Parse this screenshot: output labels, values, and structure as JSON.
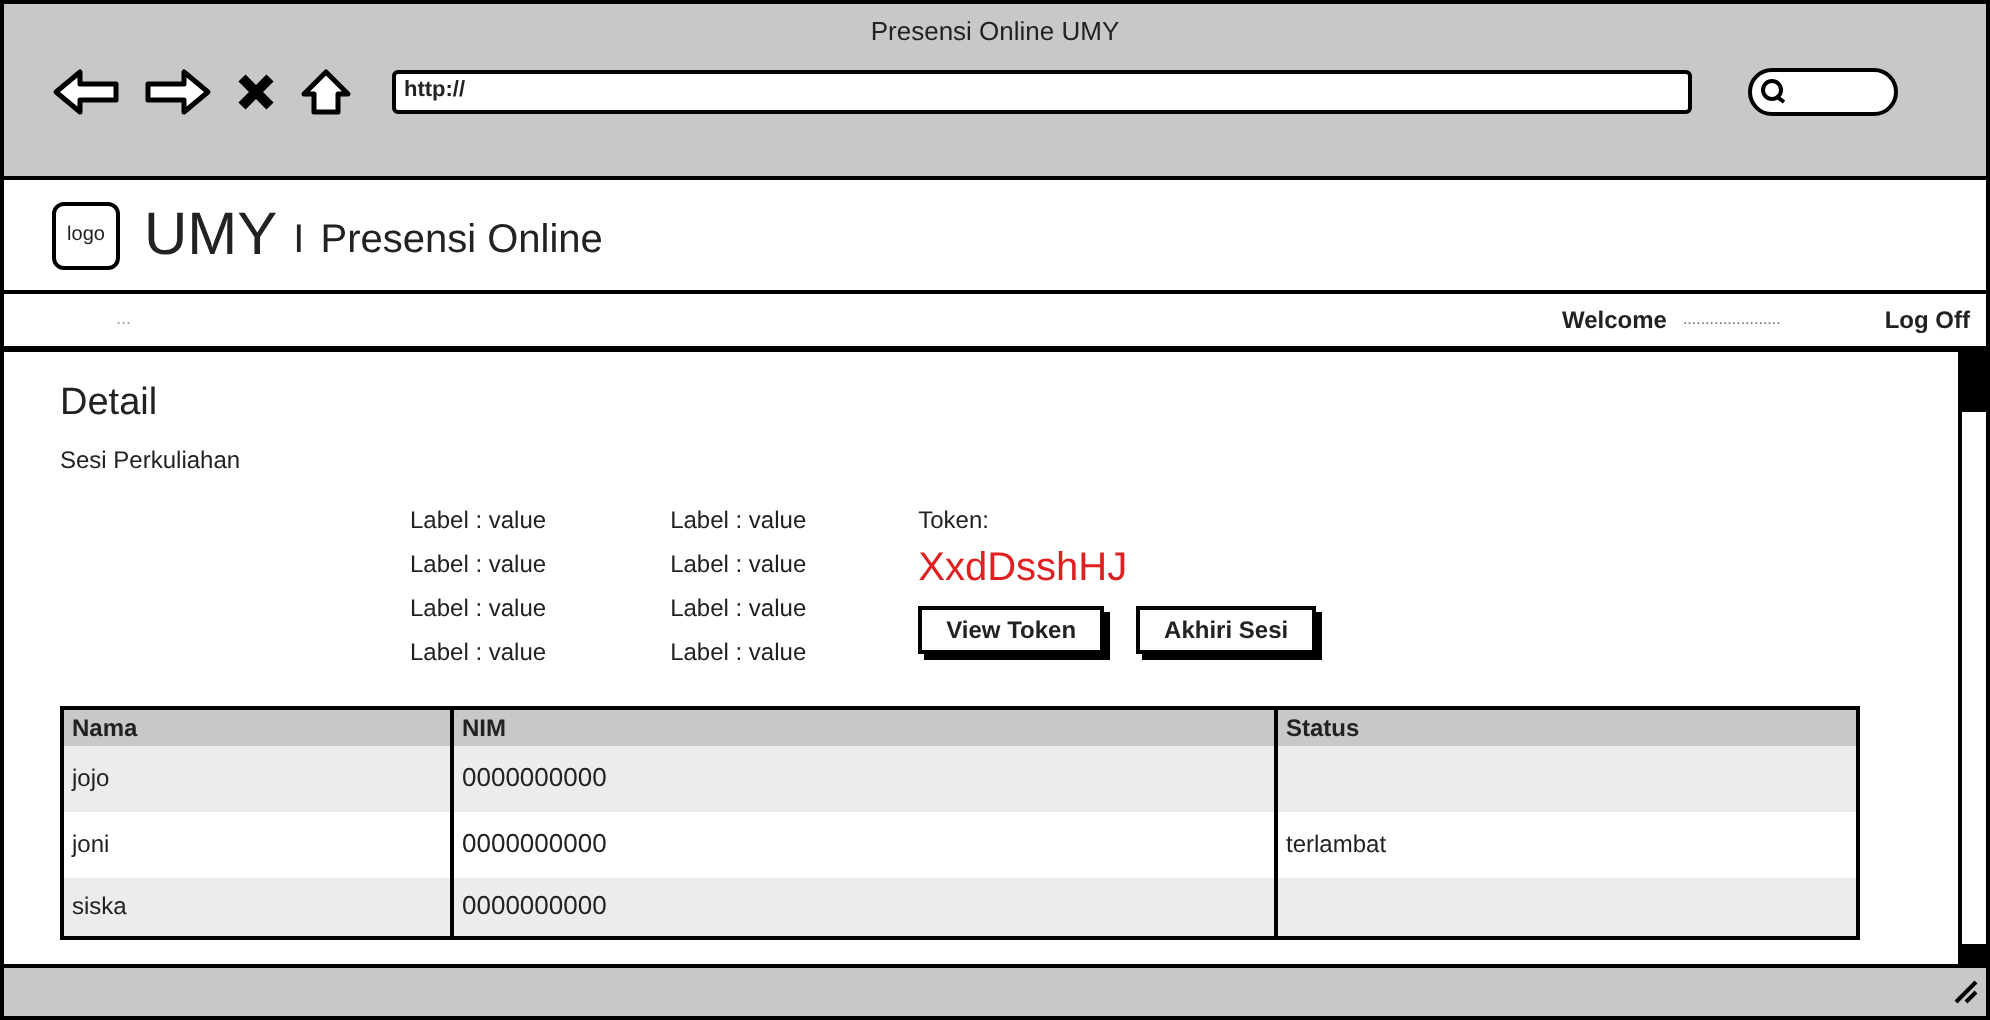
{
  "window": {
    "title": "Presensi Online UMY"
  },
  "browser": {
    "url": "http://"
  },
  "header": {
    "logo": "logo",
    "brand": "UMY",
    "separator": "I",
    "subtitle": "Presensi Online"
  },
  "nav": {
    "breadcrumb": "...",
    "welcome": "Welcome",
    "user": "......................",
    "logoff": "Log Off"
  },
  "page": {
    "title": "Detail",
    "subtitle": "Sesi Perkuliahan"
  },
  "fields": [
    [
      "Label : value",
      "Label : value",
      "Label : value",
      "Label : value"
    ],
    [
      "Label : value",
      "Label : value",
      "Label : value",
      "Label : value"
    ]
  ],
  "token": {
    "label": "Token:",
    "value": "XxdDsshHJ"
  },
  "buttons": [
    "View Token",
    "Akhiri Sesi"
  ],
  "table": {
    "columns": [
      "Nama",
      "NIM",
      "Status"
    ],
    "rows": [
      [
        "jojo",
        "0000000000",
        ""
      ],
      [
        "joni",
        "0000000000",
        "terlambat"
      ],
      [
        "siska",
        "0000000000",
        ""
      ]
    ]
  }
}
